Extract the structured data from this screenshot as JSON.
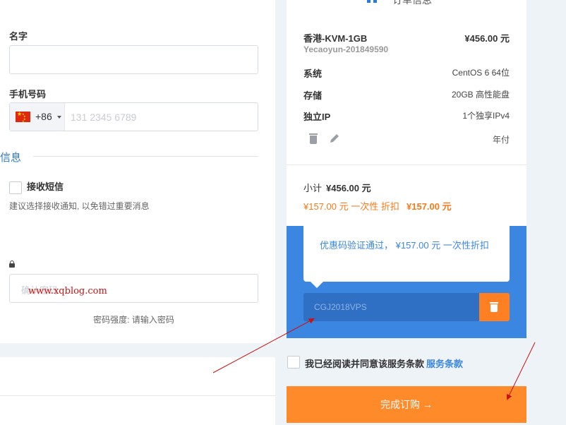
{
  "form": {
    "name_label": "名字",
    "phone_label": "手机号码",
    "phone_code": "+86",
    "phone_placeholder": "131 2345 6789",
    "section_title": "信息",
    "sms_label": "接收短信",
    "sms_help": "建议选择接收通知, 以免错过重要消息",
    "password_placeholder": "确认密码",
    "password_strength": "密码强度: 请输入密码"
  },
  "watermark": "www.xqblog.com",
  "summary": {
    "header_text": "订单信息",
    "product_name": "香港-KVM-1GB",
    "product_price": "¥456.00 元",
    "product_sub": "Yecaoyun-201849590",
    "specs": [
      {
        "label": "系统",
        "value": "CentOS 6 64位"
      },
      {
        "label": "存储",
        "value": "20GB 高性能盘"
      },
      {
        "label": "独立IP",
        "value": "1个独享IPv4"
      }
    ],
    "billing_cycle": "年付",
    "subtotal_label": "小计",
    "subtotal_amount": "¥456.00 元",
    "discount_line": "¥157.00 元 一次性 折扣",
    "discount_amount": "¥157.00 元"
  },
  "promo": {
    "message": "优惠码验证通过， ¥157.00 元 一次性折扣",
    "code": "CGJ2018VPS"
  },
  "tos": {
    "text": "我已经阅读并同意该服务条款",
    "link": "服务条款"
  },
  "checkout": {
    "button_label": "完成订购 →"
  },
  "colors": {
    "accent_blue": "#3a86e0",
    "accent_orange": "#ff8a2a",
    "annotation_red": "#cc1111"
  }
}
